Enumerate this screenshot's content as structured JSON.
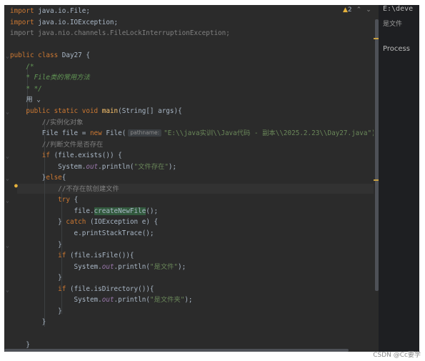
{
  "editor": {
    "warning_count": "2",
    "code_lines": [
      [
        {
          "t": "import ",
          "c": "kw"
        },
        {
          "t": "java.io.File;",
          "c": ""
        }
      ],
      [
        {
          "t": "import ",
          "c": "kw"
        },
        {
          "t": "java.io.IOException;",
          "c": ""
        }
      ],
      [
        {
          "t": "import java.nio.channels.FileLockInterruptionException;",
          "c": "cmt"
        }
      ],
      [],
      [
        {
          "t": "public class ",
          "c": "kw"
        },
        {
          "t": "Day27 {",
          "c": ""
        }
      ],
      [
        {
          "t": "    /*",
          "c": "doc"
        }
      ],
      [
        {
          "t": "    * File类的常用方法",
          "c": "doc"
        }
      ],
      [
        {
          "t": "    * */",
          "c": "doc"
        }
      ],
      [
        {
          "t": "    用 ⌄",
          "c": ""
        }
      ],
      [
        {
          "t": "    ",
          "c": ""
        },
        {
          "t": "public static void ",
          "c": "kw"
        },
        {
          "t": "main",
          "c": "fn"
        },
        {
          "t": "(String[] args){",
          "c": ""
        }
      ],
      [
        {
          "t": "        //实例化对象",
          "c": "cmt"
        }
      ],
      [
        {
          "t": "        File file = ",
          "c": ""
        },
        {
          "t": "new ",
          "c": "kw"
        },
        {
          "t": "File(",
          "c": ""
        },
        {
          "t": "pathname:",
          "c": "hint"
        },
        {
          "t": "\"E:\\\\java实训\\\\Java代码 - 副本\\\\2025.2.23\\\\Day27.java\")",
          "c": "str"
        }
      ],
      [
        {
          "t": "        //判断文件是否存在",
          "c": "cmt"
        }
      ],
      [
        {
          "t": "        ",
          "c": ""
        },
        {
          "t": "if ",
          "c": "kw"
        },
        {
          "t": "(file.exists()) {",
          "c": ""
        }
      ],
      [
        {
          "t": "            System.",
          "c": ""
        },
        {
          "t": "out",
          "c": "ital"
        },
        {
          "t": ".println(",
          "c": ""
        },
        {
          "t": "\"文件存在\"",
          "c": "str"
        },
        {
          "t": ");",
          "c": ""
        }
      ],
      [
        {
          "t": "        }",
          "c": ""
        },
        {
          "t": "else",
          "c": "kw"
        },
        {
          "t": "{",
          "c": ""
        }
      ],
      [
        {
          "t": "            //不存在就创建文件",
          "c": "cmt"
        }
      ],
      [
        {
          "t": "            ",
          "c": ""
        },
        {
          "t": "try ",
          "c": "kw"
        },
        {
          "t": "{",
          "c": ""
        }
      ],
      [
        {
          "t": "                file.",
          "c": ""
        },
        {
          "t": "createNewFile",
          "c": "hl"
        },
        {
          "t": "();",
          "c": ""
        }
      ],
      [
        {
          "t": "            } ",
          "c": ""
        },
        {
          "t": "catch ",
          "c": "kw"
        },
        {
          "t": "(IOException e) {",
          "c": ""
        }
      ],
      [
        {
          "t": "                e.printStackTrace();",
          "c": ""
        }
      ],
      [
        {
          "t": "            }",
          "c": ""
        }
      ],
      [
        {
          "t": "            ",
          "c": ""
        },
        {
          "t": "if ",
          "c": "kw"
        },
        {
          "t": "(file.isFile()){",
          "c": ""
        }
      ],
      [
        {
          "t": "                System.",
          "c": ""
        },
        {
          "t": "out",
          "c": "ital"
        },
        {
          "t": ".println(",
          "c": ""
        },
        {
          "t": "\"是文件\"",
          "c": "str"
        },
        {
          "t": ");",
          "c": ""
        }
      ],
      [
        {
          "t": "            }",
          "c": ""
        }
      ],
      [
        {
          "t": "            ",
          "c": ""
        },
        {
          "t": "if ",
          "c": "kw"
        },
        {
          "t": "(file.isDirectory()){",
          "c": ""
        }
      ],
      [
        {
          "t": "                System.",
          "c": ""
        },
        {
          "t": "out",
          "c": "ital"
        },
        {
          "t": ".println(",
          "c": ""
        },
        {
          "t": "\"是文件夹\"",
          "c": "str"
        },
        {
          "t": ");",
          "c": ""
        }
      ],
      [
        {
          "t": "            }",
          "c": ""
        }
      ],
      [
        {
          "t": "        }",
          "c": ""
        }
      ],
      [],
      [
        {
          "t": "    }",
          "c": ""
        }
      ]
    ]
  },
  "right_panel": {
    "path": "E:\\deve",
    "file": "是文件",
    "process": "Process"
  },
  "watermark": "CSDN @Cc要学"
}
